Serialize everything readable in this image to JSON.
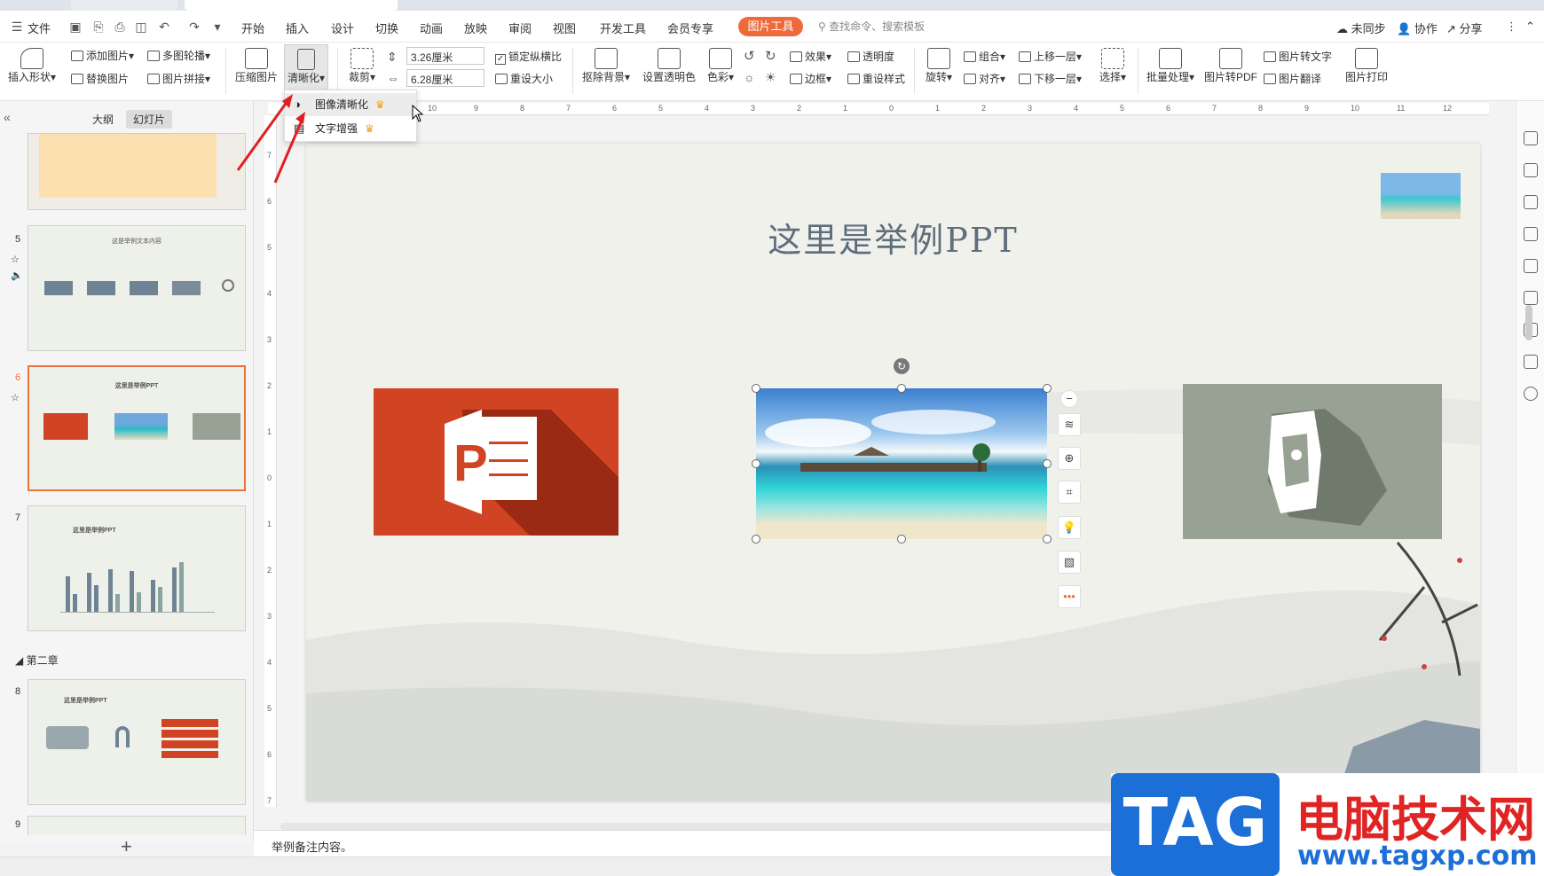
{
  "menu": {
    "file_label": "文件",
    "tabs": [
      "开始",
      "插入",
      "设计",
      "切换",
      "动画",
      "放映",
      "审阅",
      "视图",
      "开发工具",
      "会员专享"
    ],
    "active_tab": "图片工具",
    "search_placeholder": "查找命令、搜索模板",
    "sync_label": "未同步",
    "collab_label": "协作",
    "share_label": "分享"
  },
  "ribbon": {
    "insert_shape": "插入形状",
    "add_picture": "添加图片",
    "multi_carousel": "多图轮播",
    "replace_picture": "替换图片",
    "picture_splice": "图片拼接",
    "compress": "压缩图片",
    "sharpen": "清晰化",
    "crop": "裁剪",
    "height_value": "3.26厘米",
    "width_value": "6.28厘米",
    "lock_ratio": "锁定纵横比",
    "reset_size": "重设大小",
    "remove_bg": "抠除背景",
    "set_transparent": "设置透明色",
    "color": "色彩",
    "effect": "效果",
    "transparency": "透明度",
    "border": "边框",
    "reset_style": "重设样式",
    "rotate": "旋转",
    "group": "组合",
    "align": "对齐",
    "bring_forward": "上移一层",
    "send_backward": "下移一层",
    "select": "选择",
    "batch": "批量处理",
    "to_pdf": "图片转PDF",
    "to_text": "图片转文字",
    "translate": "图片翻译",
    "print": "图片打印"
  },
  "dropdown": {
    "items": [
      "图像清晰化",
      "文字增强"
    ]
  },
  "left_panel": {
    "tab_outline": "大纲",
    "tab_slides": "幻灯片",
    "slide_numbers": [
      "5",
      "6",
      "7",
      "8",
      "9"
    ],
    "section_label": "第二章",
    "thumb5_title": "这是举例文本内容",
    "thumb6_title": "这里是举例PPT",
    "thumb7_title": "这里是举例PPT",
    "thumb8_title": "这里是举例PPT",
    "add_slide": "+"
  },
  "ruler": {
    "h_ticks": [
      "10",
      "9",
      "8",
      "7",
      "6",
      "5",
      "4",
      "3",
      "2",
      "1",
      "0",
      "1",
      "2",
      "3",
      "4",
      "5",
      "6",
      "7",
      "8",
      "9",
      "10",
      "11",
      "12"
    ],
    "v_ticks": [
      "7",
      "6",
      "5",
      "4",
      "3",
      "2",
      "1",
      "0",
      "1",
      "2",
      "3",
      "4",
      "5",
      "6",
      "7"
    ]
  },
  "slide": {
    "title": "这里是举例PPT"
  },
  "notes": {
    "text": "举例备注内容。"
  },
  "watermark": {
    "tag": "TAG",
    "site_name": "电脑技术网",
    "url": "www.tagxp.com"
  },
  "colors": {
    "accent": "#ee6a3a",
    "ppt_red": "#d04423",
    "slide_bg": "#f1f1ec",
    "title_color": "#5d6f7c",
    "gray_box": "#97a294"
  }
}
